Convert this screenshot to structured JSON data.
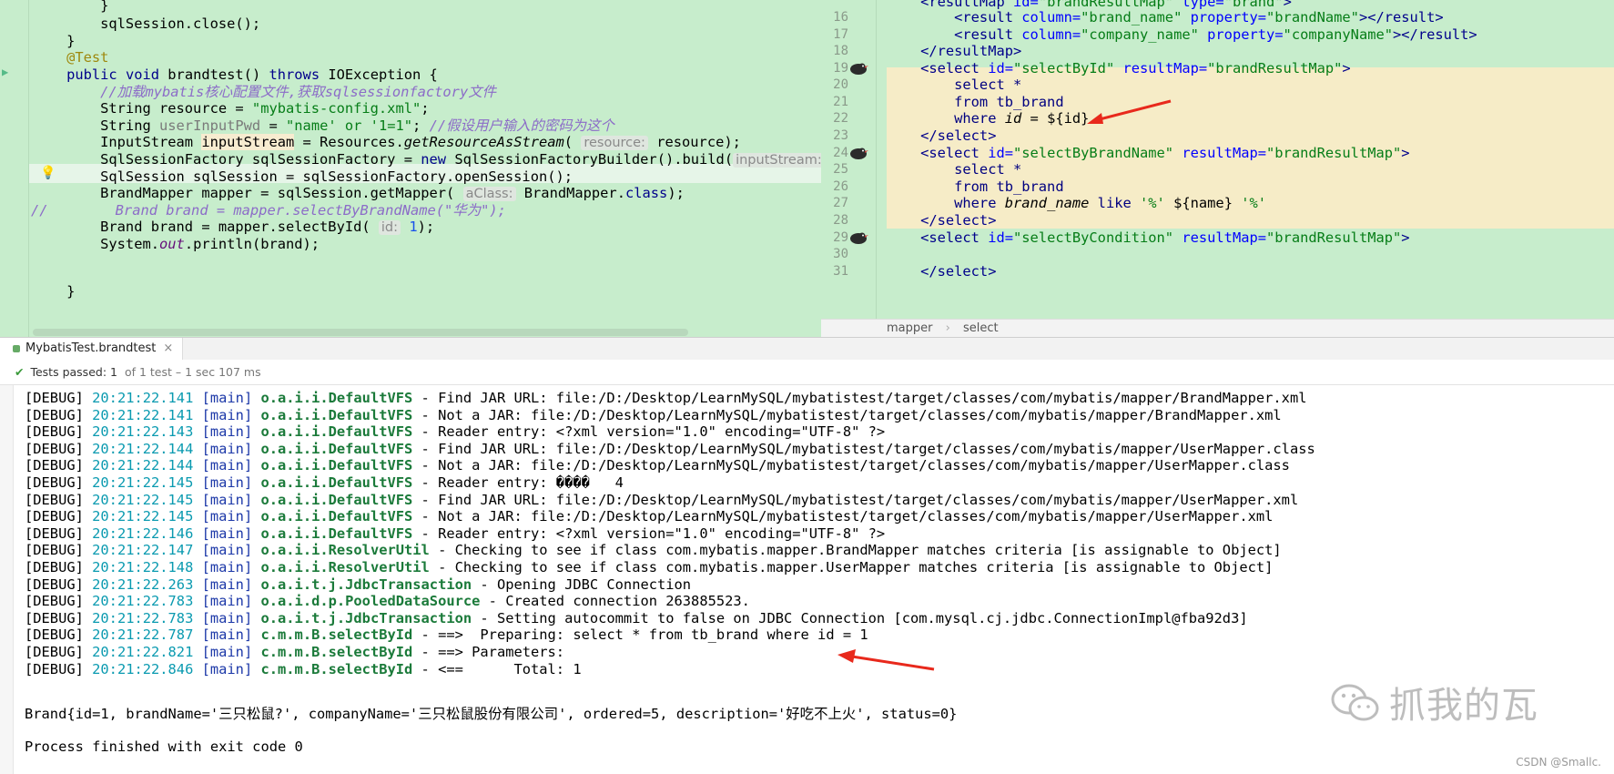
{
  "left_editor": {
    "lines": [
      {
        "t": "        }"
      },
      {
        "t": "        sqlSession.close();"
      },
      {
        "t": "    }"
      },
      {
        "t": "    @Test"
      },
      {
        "t": "    public void brandtest() throws IOException {"
      },
      {
        "t": "        //加载mybatis核心配置文件,获取sqlsessionfactory文件"
      },
      {
        "t": "        String resource = \"mybatis-config.xml\";"
      },
      {
        "t": "        String userInputPwd = \"name' or '1=1\"; //假设用户输入的密码为这个"
      },
      {
        "t": "        InputStream inputStream = Resources.getResourceAsStream( resource: resource);"
      },
      {
        "t": "        SqlSessionFactory sqlSessionFactory = new SqlSessionFactoryBuilder().build( inputStream: i"
      },
      {
        "t": "        SqlSession sqlSession = sqlSessionFactory.openSession();"
      },
      {
        "t": "        BrandMapper mapper = sqlSession.getMapper( aClass: BrandMapper.class);"
      },
      {
        "t": "//        Brand brand = mapper.selectByBrandName(\"华为\");"
      },
      {
        "t": "        Brand brand = mapper.selectById( id: 1);"
      },
      {
        "t": "        System.out.println(brand);"
      },
      {
        "t": "    }"
      }
    ]
  },
  "right_editor": {
    "line_numbers": [
      "16",
      "17",
      "18",
      "19",
      "20",
      "21",
      "22",
      "23",
      "24",
      "25",
      "26",
      "27",
      "28",
      "29",
      "30",
      "31"
    ],
    "top_partial": "    <resultMap id=\"brandResultMap\" type=\"brand\">",
    "lines": [
      "        <result column=\"brand_name\" property=\"brandName\"></result>",
      "        <result column=\"company_name\" property=\"companyName\"></result>",
      "    </resultMap>",
      "    <select id=\"selectById\" resultMap=\"brandResultMap\">",
      "        select *",
      "        from tb_brand",
      "        where id = ${id}",
      "    </select>",
      "    <select id=\"selectByBrandName\" resultMap=\"brandResultMap\">",
      "        select *",
      "        from tb_brand",
      "        where brand_name like '%' ${name} '%'",
      "    </select>",
      "    <select id=\"selectByCondition\" resultMap=\"brandResultMap\">",
      "",
      "    </select>"
    ],
    "breadcrumb": [
      "mapper",
      "select"
    ]
  },
  "run_panel": {
    "tab_label": "MybatisTest.brandtest",
    "status_passed": "Tests passed: 1",
    "status_rest": "of 1 test – 1 sec 107 ms"
  },
  "console": {
    "lines": [
      {
        "lvl": "[DEBUG]",
        "ts": "20:21:22.141",
        "thr": "[main]",
        "lg": "o.a.i.i.DefaultVFS",
        "msg": " - Find JAR URL: file:/D:/Desktop/LearnMySQL/mybatistest/target/classes/com/mybatis/mapper/BrandMapper.xml"
      },
      {
        "lvl": "[DEBUG]",
        "ts": "20:21:22.141",
        "thr": "[main]",
        "lg": "o.a.i.i.DefaultVFS",
        "msg": " - Not a JAR: file:/D:/Desktop/LearnMySQL/mybatistest/target/classes/com/mybatis/mapper/BrandMapper.xml"
      },
      {
        "lvl": "[DEBUG]",
        "ts": "20:21:22.143",
        "thr": "[main]",
        "lg": "o.a.i.i.DefaultVFS",
        "msg": " - Reader entry: <?xml version=\"1.0\" encoding=\"UTF-8\" ?>"
      },
      {
        "lvl": "[DEBUG]",
        "ts": "20:21:22.144",
        "thr": "[main]",
        "lg": "o.a.i.i.DefaultVFS",
        "msg": " - Find JAR URL: file:/D:/Desktop/LearnMySQL/mybatistest/target/classes/com/mybatis/mapper/UserMapper.class"
      },
      {
        "lvl": "[DEBUG]",
        "ts": "20:21:22.144",
        "thr": "[main]",
        "lg": "o.a.i.i.DefaultVFS",
        "msg": " - Not a JAR: file:/D:/Desktop/LearnMySQL/mybatistest/target/classes/com/mybatis/mapper/UserMapper.class"
      },
      {
        "lvl": "[DEBUG]",
        "ts": "20:21:22.145",
        "thr": "[main]",
        "lg": "o.a.i.i.DefaultVFS",
        "msg": " - Reader entry: ����   4"
      },
      {
        "lvl": "[DEBUG]",
        "ts": "20:21:22.145",
        "thr": "[main]",
        "lg": "o.a.i.i.DefaultVFS",
        "msg": " - Find JAR URL: file:/D:/Desktop/LearnMySQL/mybatistest/target/classes/com/mybatis/mapper/UserMapper.xml"
      },
      {
        "lvl": "[DEBUG]",
        "ts": "20:21:22.145",
        "thr": "[main]",
        "lg": "o.a.i.i.DefaultVFS",
        "msg": " - Not a JAR: file:/D:/Desktop/LearnMySQL/mybatistest/target/classes/com/mybatis/mapper/UserMapper.xml"
      },
      {
        "lvl": "[DEBUG]",
        "ts": "20:21:22.146",
        "thr": "[main]",
        "lg": "o.a.i.i.DefaultVFS",
        "msg": " - Reader entry: <?xml version=\"1.0\" encoding=\"UTF-8\" ?>"
      },
      {
        "lvl": "[DEBUG]",
        "ts": "20:21:22.147",
        "thr": "[main]",
        "lg": "o.a.i.i.ResolverUtil",
        "msg": " - Checking to see if class com.mybatis.mapper.BrandMapper matches criteria [is assignable to Object]"
      },
      {
        "lvl": "[DEBUG]",
        "ts": "20:21:22.148",
        "thr": "[main]",
        "lg": "o.a.i.i.ResolverUtil",
        "msg": " - Checking to see if class com.mybatis.mapper.UserMapper matches criteria [is assignable to Object]"
      },
      {
        "lvl": "[DEBUG]",
        "ts": "20:21:22.263",
        "thr": "[main]",
        "lg": "o.a.i.t.j.JdbcTransaction",
        "msg": " - Opening JDBC Connection"
      },
      {
        "lvl": "[DEBUG]",
        "ts": "20:21:22.783",
        "thr": "[main]",
        "lg": "o.a.i.d.p.PooledDataSource",
        "msg": " - Created connection 263885523."
      },
      {
        "lvl": "[DEBUG]",
        "ts": "20:21:22.783",
        "thr": "[main]",
        "lg": "o.a.i.t.j.JdbcTransaction",
        "msg": " - Setting autocommit to false on JDBC Connection [com.mysql.cj.jdbc.ConnectionImpl@fba92d3]"
      },
      {
        "lvl": "[DEBUG]",
        "ts": "20:21:22.787",
        "thr": "[main]",
        "lg": "c.m.m.B.selectById",
        "msg": " - ==>  Preparing: select * from tb_brand where id = 1"
      },
      {
        "lvl": "[DEBUG]",
        "ts": "20:21:22.821",
        "thr": "[main]",
        "lg": "c.m.m.B.selectById",
        "msg": " - ==> Parameters: "
      },
      {
        "lvl": "[DEBUG]",
        "ts": "20:21:22.846",
        "thr": "[main]",
        "lg": "c.m.m.B.selectById",
        "msg": " - <==      Total: 1"
      }
    ],
    "result_line": "Brand{id=1, brandName='三只松鼠?', companyName='三只松鼠股份有限公司', ordered=5, description='好吃不上火', status=0}",
    "finish_line": "Process finished with exit code 0"
  },
  "watermark": "抓我的瓦",
  "csdn_mark": "CSDN @Smallc."
}
